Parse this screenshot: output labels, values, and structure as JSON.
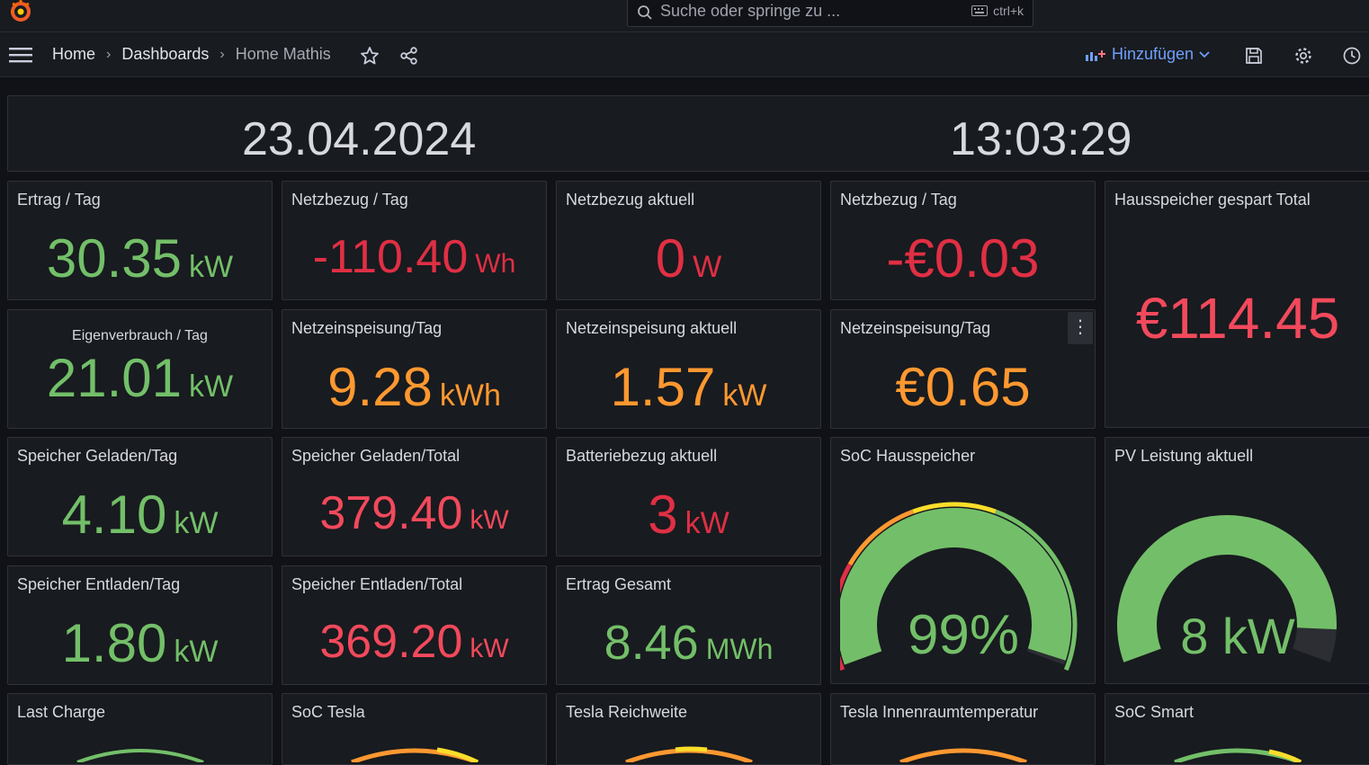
{
  "search": {
    "placeholder": "Suche oder springe zu ...",
    "shortcut": "ctrl+k"
  },
  "breadcrumb": {
    "home": "Home",
    "sep": "›",
    "dashboards": "Dashboards",
    "current": "Home Mathis"
  },
  "toolbar": {
    "add_label": "Hinzufügen"
  },
  "header": {
    "date": "23.04.2024",
    "time": "13:03:29"
  },
  "colors": {
    "green": "#73bf69",
    "red": "#e02f44",
    "orange": "#ff9830",
    "pink": "#f2495c",
    "accent": "#6e9fff"
  },
  "panels": {
    "ertrag_tag": {
      "title": "Ertrag / Tag",
      "value": "30.35",
      "unit": "kW"
    },
    "netzbezug_tag": {
      "title": "Netzbezug / Tag",
      "value": "-110.40",
      "unit": "Wh"
    },
    "netzbezug_aktuell": {
      "title": "Netzbezug aktuell",
      "value": "0",
      "unit": "W"
    },
    "netzbezug_tag_eur": {
      "title": "Netzbezug / Tag",
      "value": "-€0.03"
    },
    "hausspeicher_total": {
      "title": "Hausspeicher gespart Total",
      "value": "€114.45"
    },
    "eigenverbrauch": {
      "title": "Eigenverbrauch / Tag",
      "value": "21.01",
      "unit": "kW"
    },
    "netzeinspeisung_tag": {
      "title": "Netzeinspeisung/Tag",
      "value": "9.28",
      "unit": "kWh"
    },
    "netzeinspeisung_aktuell": {
      "title": "Netzeinspeisung aktuell",
      "value": "1.57",
      "unit": "kW"
    },
    "netzeinspeisung_tag_eur": {
      "title": "Netzeinspeisung/Tag",
      "value": "€0.65",
      "menu": "⋮"
    },
    "speicher_geladen_tag": {
      "title": "Speicher Geladen/Tag",
      "value": "4.10",
      "unit": "kW"
    },
    "speicher_geladen_total": {
      "title": "Speicher Geladen/Total",
      "value": "379.40",
      "unit": "kW"
    },
    "batteriebezug": {
      "title": "Batteriebezug aktuell",
      "value": "3",
      "unit": "kW"
    },
    "soc_hausspeicher": {
      "title": "SoC Hausspeicher",
      "value": "99%",
      "level": 0.99
    },
    "pv_leistung": {
      "title": "PV Leistung aktuell",
      "value": "8 kW",
      "level": 0.92
    },
    "speicher_entladen_tag": {
      "title": "Speicher Entladen/Tag",
      "value": "1.80",
      "unit": "kW"
    },
    "speicher_entladen_total": {
      "title": "Speicher Entladen/Total",
      "value": "369.20",
      "unit": "kW"
    },
    "ertrag_gesamt": {
      "title": "Ertrag Gesamt",
      "value": "8.46",
      "unit": "MWh"
    },
    "last_charge": {
      "title": "Last Charge"
    },
    "soc_tesla": {
      "title": "SoC Tesla"
    },
    "tesla_reichweite": {
      "title": "Tesla Reichweite"
    },
    "tesla_temp": {
      "title": "Tesla Innenraumtemperatur"
    },
    "soc_smart": {
      "title": "SoC Smart"
    }
  }
}
